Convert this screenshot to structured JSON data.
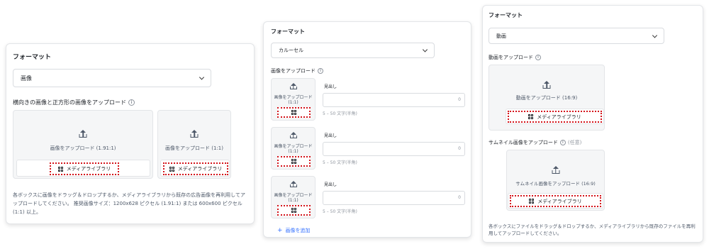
{
  "panel1": {
    "title": "フォーマット",
    "select_value": "画像",
    "section_label": "横向きの画像と正方形の画像をアップロード",
    "boxes": [
      {
        "upload_text": "画像をアップロード (1.91:1)",
        "lib_label": "メディアライブラリ"
      },
      {
        "upload_text": "画像をアップロード (1:1)",
        "lib_label": "メディアライブラリ"
      }
    ],
    "help_text": "各ボックスに画像をドラッグ＆ドロップするか、メディアライブラリから既存の広告画像を再利用してアップロードしてください。 推奨画像サイズ：1200x628 ピクセル (1.91:1) または 600x600 ピクセル (1:1) 以上。"
  },
  "panel2": {
    "title": "フォーマット",
    "select_value": "カルーセル",
    "section_label": "画像をアップロード",
    "cards": [
      {
        "upload_line1": "画像をアップロード",
        "upload_line2": "(1:1)",
        "headline_label": "見出し",
        "count": "0",
        "hint": "5 – 50 文字(半角)"
      },
      {
        "upload_line1": "画像をアップロード",
        "upload_line2": "(1:1)",
        "headline_label": "見出し",
        "count": "0",
        "hint": "5 – 50 文字(半角)"
      },
      {
        "upload_line1": "画像をアップロード",
        "upload_line2": "(1:1)",
        "headline_label": "見出し",
        "count": "0",
        "hint": "5 – 50 文字(半角)"
      }
    ],
    "add_label": "画像を追加"
  },
  "panel3": {
    "title": "フォーマット",
    "select_value": "動画",
    "video_label": "動画をアップロード",
    "video_upload_text": "動画をアップロード (16:9)",
    "video_lib_label": "メディアライブラリ",
    "thumb_label": "サムネイル画像をアップロード",
    "thumb_optional": "(任意)",
    "thumb_upload_text": "サムネイル画像をアップロード (16:9)",
    "thumb_lib_label": "メディアライブラリ",
    "help_text": "各ボックスにファイルをドラッグ＆ドロップするか、メディアライブラリから既存のファイルを再利用してアップロードしてください。"
  },
  "icons": {
    "upload": "upload-icon",
    "media": "media-grid-icon",
    "chevron": "chevron-down-icon",
    "info": "info-icon",
    "plus": "plus-icon"
  },
  "colors": {
    "highlight": "#d4141b",
    "link": "#3370ff",
    "box_bg": "#f5f6f7"
  }
}
